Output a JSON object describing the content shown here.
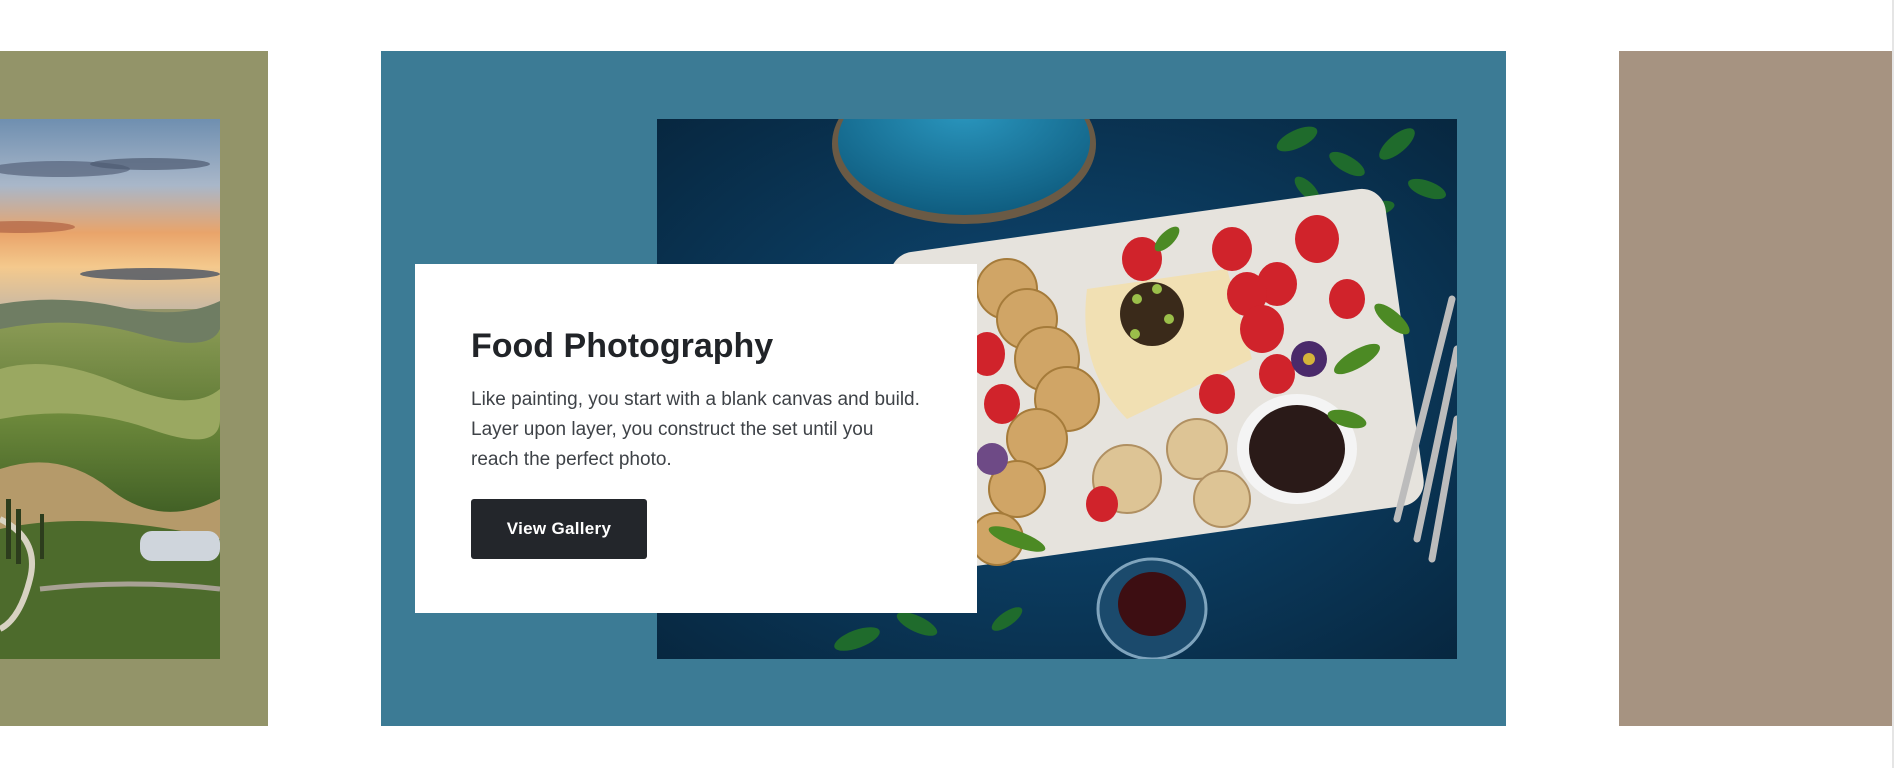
{
  "carousel": {
    "active_slide": {
      "title": "Food Photography",
      "description": "Like painting, you start with a blank canvas and build. Layer upon layer, you construct the set until you reach the perfect photo.",
      "button_label": "View Gallery",
      "background_color": "#3c7b95",
      "image_subject": "food-platter-photo"
    },
    "previous_slide": {
      "background_color": "#939469",
      "image_subject": "landscape-hills-sunset-photo"
    },
    "next_slide": {
      "background_color": "#a69381"
    }
  }
}
